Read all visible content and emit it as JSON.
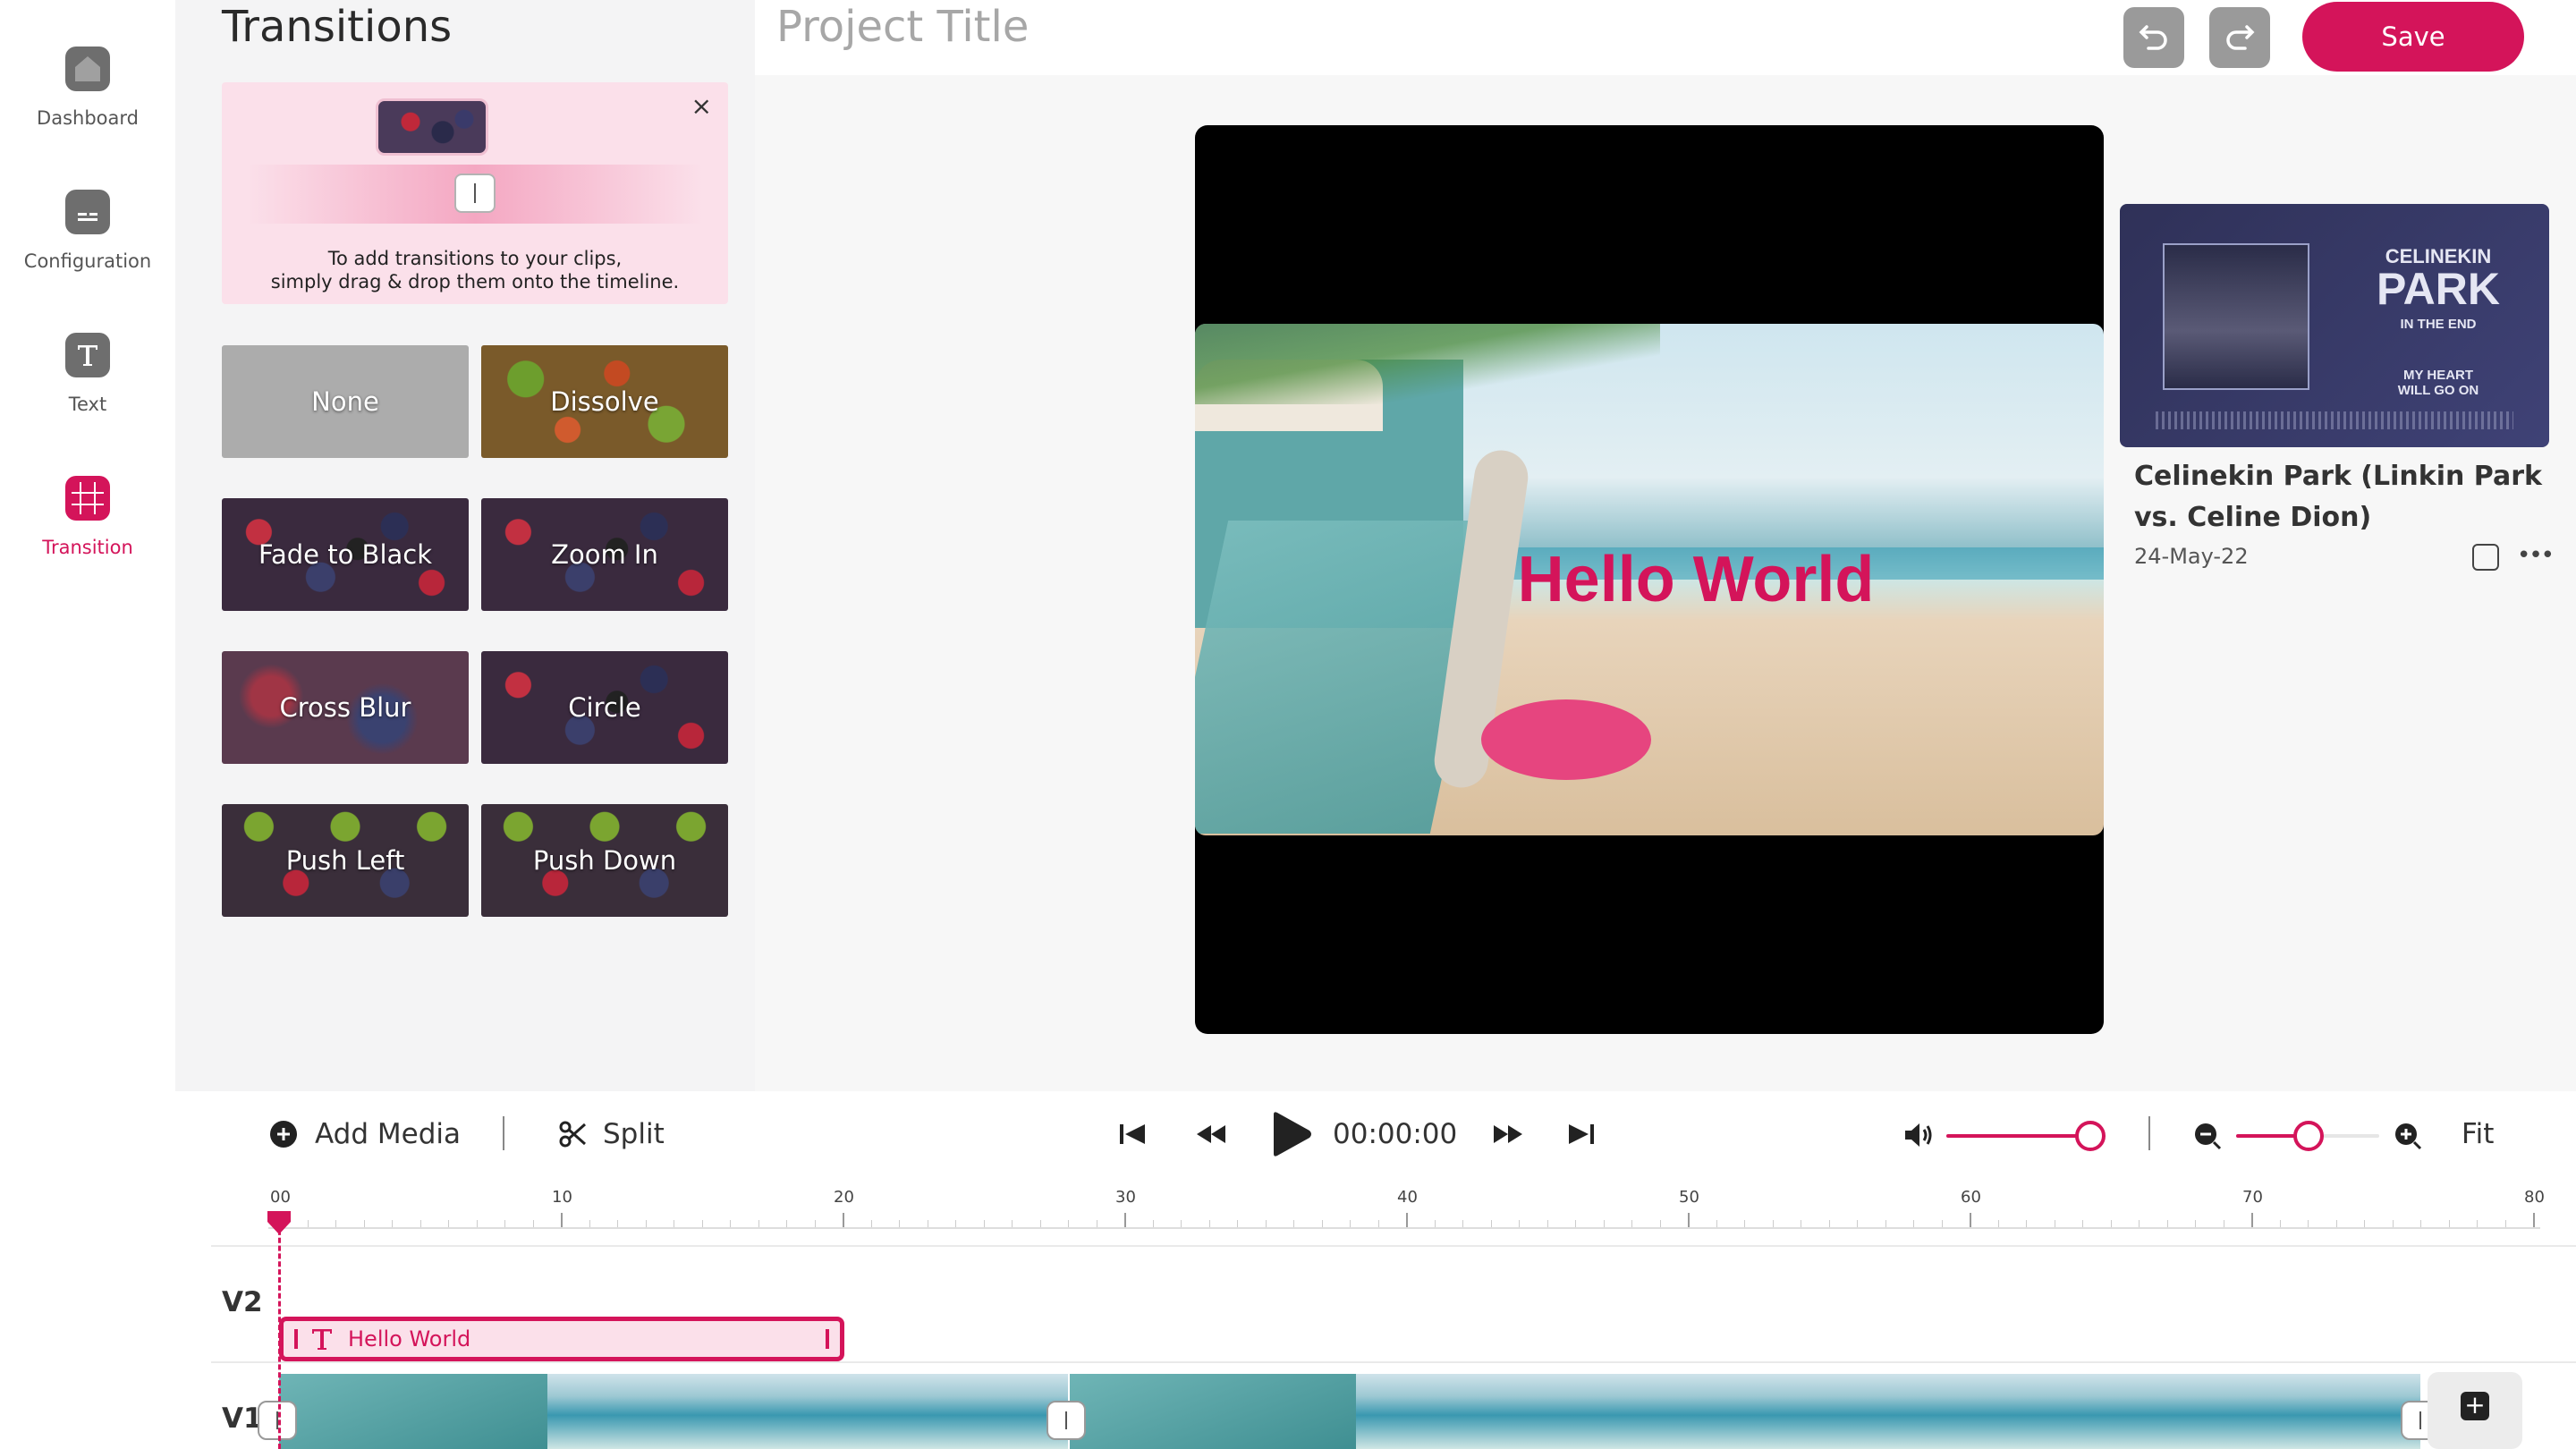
{
  "nav": {
    "items": [
      {
        "label": "Dashboard",
        "icon": "home-icon"
      },
      {
        "label": "Configuration",
        "icon": "subtitles-icon"
      },
      {
        "label": "Text",
        "icon": "text-icon"
      },
      {
        "label": "Transition",
        "icon": "transition-grid-icon",
        "active": true
      }
    ]
  },
  "panel": {
    "title": "Transitions",
    "hint": {
      "line1": "To add transitions to your clips,",
      "line2": "simply drag & drop them onto the timeline.",
      "close": "×"
    },
    "transitions": [
      {
        "label": "None"
      },
      {
        "label": "Dissolve"
      },
      {
        "label": "Fade to Black"
      },
      {
        "label": "Zoom In"
      },
      {
        "label": "Cross Blur"
      },
      {
        "label": "Circle"
      },
      {
        "label": "Push Left"
      },
      {
        "label": "Push Down"
      }
    ]
  },
  "header": {
    "project_title": "Project Title",
    "save_label": "Save"
  },
  "preview": {
    "overlay_text": "Hello World"
  },
  "media": {
    "logo_line1": "CELINEKIN",
    "logo_line2": "PARK",
    "logo_line3": "IN THE END",
    "logo_line4": "MY HEART",
    "logo_line5": "WILL GO ON",
    "title": "Celinekin Park (Linkin Park vs. Celine Dion)",
    "date": "24-May-22",
    "more": "•••"
  },
  "toolbar": {
    "add_media_label": "Add Media",
    "split_label": "Split",
    "timecode": "00:00:00",
    "volume": 1.0,
    "zoom_level": 0.5,
    "fit_label": "Fit"
  },
  "timeline": {
    "ticks": [
      "00",
      "10",
      "20",
      "30",
      "40",
      "50",
      "60",
      "70",
      "80"
    ],
    "tracks": [
      {
        "label": "V2"
      },
      {
        "label": "V1"
      }
    ],
    "text_clip_label": "Hello World"
  },
  "colors": {
    "accent": "#d4145a",
    "nav_icon": "#6e6e6e",
    "panel_bg": "#f4f4f5"
  }
}
